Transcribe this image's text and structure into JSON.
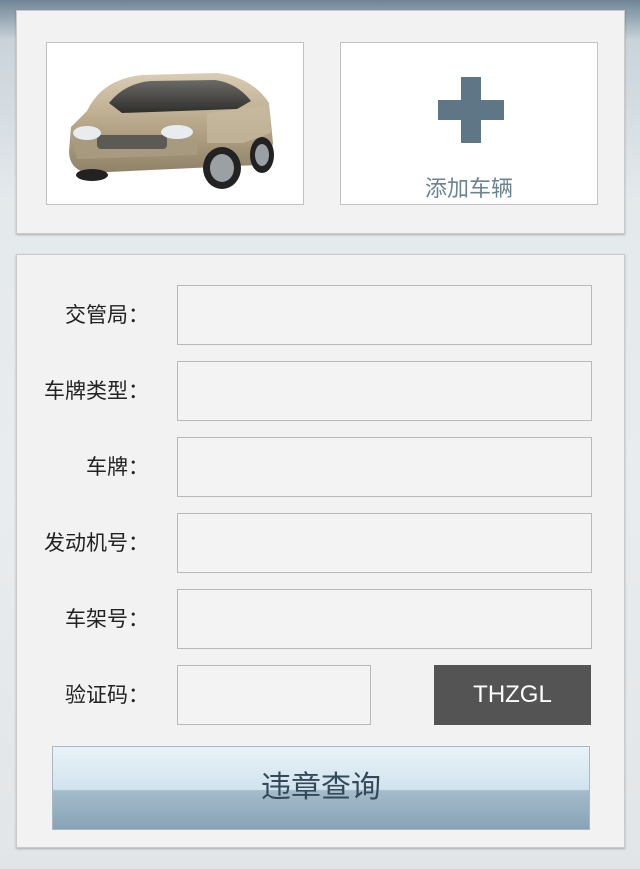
{
  "vehicles": {
    "add_vehicle_label": "添加车辆"
  },
  "form": {
    "fields": [
      {
        "label": "交管局：",
        "value": ""
      },
      {
        "label": "车牌类型：",
        "value": ""
      },
      {
        "label": "车牌：",
        "value": ""
      },
      {
        "label": "发动机号：",
        "value": ""
      },
      {
        "label": "车架号：",
        "value": ""
      }
    ],
    "captcha": {
      "label": "验证码：",
      "value": "",
      "code": "THZGL"
    },
    "submit_label": "违章查询"
  },
  "colors": {
    "accent": "#5e7686",
    "captcha_bg": "#545454"
  },
  "icons": [
    "plus-icon"
  ]
}
